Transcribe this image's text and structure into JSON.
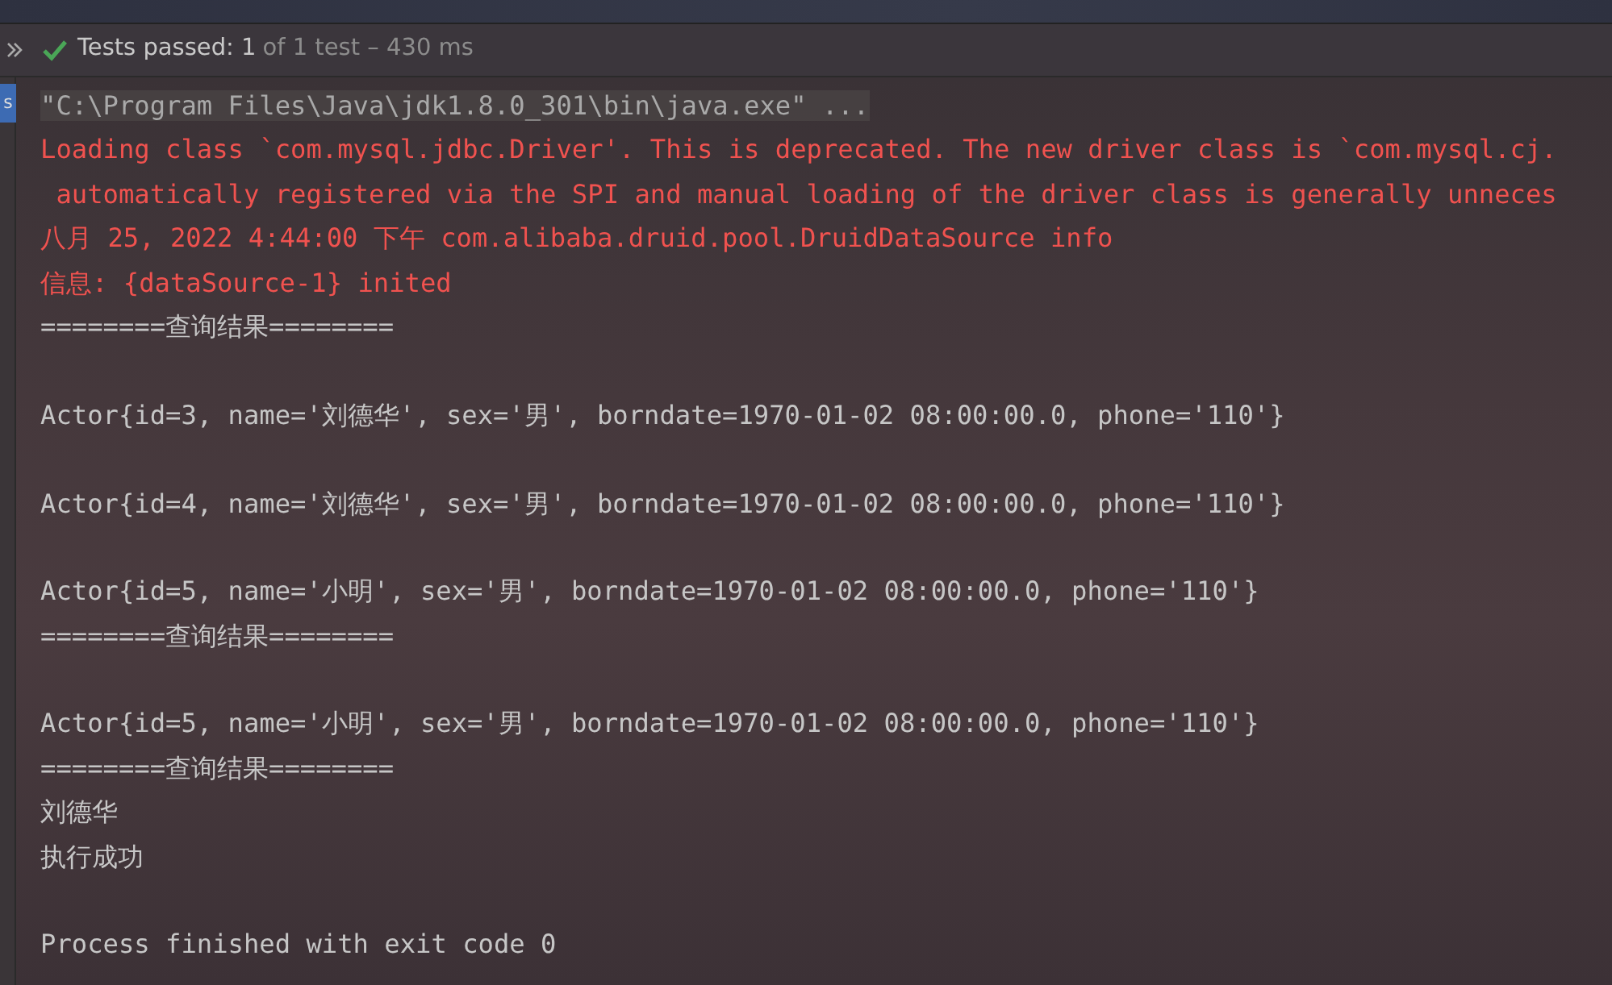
{
  "test_status": {
    "passed": true,
    "label": "Tests passed:",
    "count": "1",
    "detail": "of 1 test – 430 ms"
  },
  "side_tabs": [
    {
      "label": "s",
      "selected": true
    }
  ],
  "console_lines": [
    {
      "kind": "command",
      "text": "\"C:\\Program Files\\Java\\jdk1.8.0_301\\bin\\java.exe\" ..."
    },
    {
      "kind": "error",
      "text": "Loading class `com.mysql.jdbc.Driver'. This is deprecated. The new driver class is `com.mysql.cj."
    },
    {
      "kind": "error",
      "text": " automatically registered via the SPI and manual loading of the driver class is generally unneces"
    },
    {
      "kind": "error",
      "text": "八月 25, 2022 4:44:00 下午 com.alibaba.druid.pool.DruidDataSource info"
    },
    {
      "kind": "error",
      "text": "信息: {dataSource-1} inited"
    },
    {
      "kind": "output",
      "text": "========查询结果========"
    },
    {
      "kind": "blank"
    },
    {
      "kind": "output",
      "text": "Actor{id=3, name='刘德华', sex='男', borndate=1970-01-02 08:00:00.0, phone='110'}"
    },
    {
      "kind": "blank"
    },
    {
      "kind": "output",
      "text": "Actor{id=4, name='刘德华', sex='男', borndate=1970-01-02 08:00:00.0, phone='110'}"
    },
    {
      "kind": "blank"
    },
    {
      "kind": "output",
      "text": "Actor{id=5, name='小明', sex='男', borndate=1970-01-02 08:00:00.0, phone='110'}"
    },
    {
      "kind": "output",
      "text": "========查询结果========"
    },
    {
      "kind": "blank"
    },
    {
      "kind": "output",
      "text": "Actor{id=5, name='小明', sex='男', borndate=1970-01-02 08:00:00.0, phone='110'}"
    },
    {
      "kind": "output",
      "text": "========查询结果========"
    },
    {
      "kind": "output",
      "text": "刘德华"
    },
    {
      "kind": "output",
      "text": "执行成功"
    },
    {
      "kind": "blank"
    },
    {
      "kind": "output",
      "text": "Process finished with exit code 0"
    }
  ]
}
